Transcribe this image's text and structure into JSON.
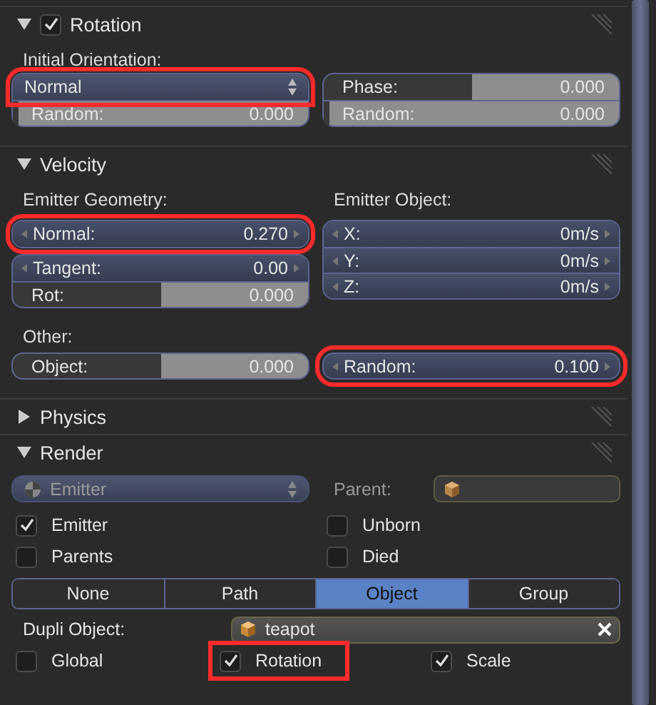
{
  "rotation": {
    "title": "Rotation",
    "expanded": true,
    "enabled": true,
    "orientation_label": "Initial Orientation:",
    "orientation": {
      "value": "Normal",
      "highlighted": true
    },
    "left": [
      {
        "kind": "slider",
        "label": "Random:",
        "value": "0.000",
        "level": 0.02
      }
    ],
    "right": [
      {
        "kind": "slider",
        "label": "Phase:",
        "value": "0.000",
        "level": 0.5
      },
      {
        "kind": "slider",
        "label": "Random:",
        "value": "0.000",
        "level": 0.02
      }
    ]
  },
  "velocity": {
    "title": "Velocity",
    "expanded": true,
    "geometry_label": "Emitter Geometry:",
    "object_label": "Emitter Object:",
    "geometry_highlight": [
      {
        "kind": "number",
        "label": "Normal:",
        "value": "0.270",
        "highlighted": true
      }
    ],
    "geometry": [
      {
        "kind": "number",
        "label": "Tangent:",
        "value": "0.00"
      },
      {
        "kind": "slider",
        "label": "Rot:",
        "value": "0.000",
        "level": 0.5
      }
    ],
    "object": [
      {
        "kind": "number",
        "label": "X:",
        "value": "0m/s"
      },
      {
        "kind": "number",
        "label": "Y:",
        "value": "0m/s"
      },
      {
        "kind": "number",
        "label": "Z:",
        "value": "0m/s"
      }
    ],
    "other_label": "Other:",
    "other": [
      {
        "kind": "slider",
        "label": "Object:",
        "value": "0.000",
        "level": 0.5,
        "highlighted": false
      },
      {
        "kind": "number",
        "label": "Random:",
        "value": "0.100",
        "highlighted": true
      }
    ]
  },
  "physics": {
    "title": "Physics",
    "expanded": false
  },
  "render": {
    "title": "Render",
    "expanded": true,
    "mode": {
      "value": "Emitter",
      "disabled": true
    },
    "parent_label": "Parent:",
    "checkboxes": [
      {
        "label": "Emitter",
        "checked": true
      },
      {
        "label": "Unborn",
        "checked": false
      },
      {
        "label": "Parents",
        "checked": false
      },
      {
        "label": "Died",
        "checked": false
      }
    ],
    "tabs": [
      {
        "label": "None",
        "selected": false
      },
      {
        "label": "Path",
        "selected": false
      },
      {
        "label": "Object",
        "selected": true
      },
      {
        "label": "Group",
        "selected": false
      }
    ],
    "dupli_label": "Dupli Object:",
    "dupli_object": "teapot",
    "options": [
      {
        "label": "Global",
        "checked": false,
        "highlighted": false
      },
      {
        "label": "Rotation",
        "checked": true,
        "highlighted": true
      },
      {
        "label": "Scale",
        "checked": true,
        "highlighted": false
      }
    ]
  }
}
